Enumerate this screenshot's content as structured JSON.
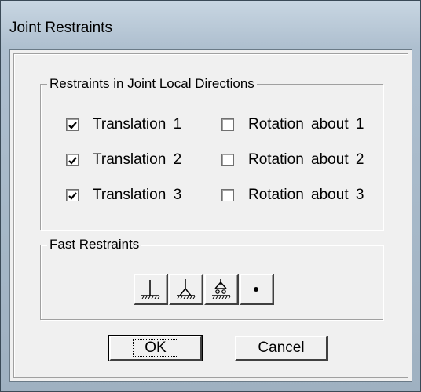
{
  "window": {
    "title": "Joint Restraints"
  },
  "restraints_group": {
    "label": "Restraints in Joint Local Directions",
    "checkboxes": [
      {
        "label": "Translation 1",
        "checked": true
      },
      {
        "label": "Translation 2",
        "checked": true
      },
      {
        "label": "Translation 3",
        "checked": true
      },
      {
        "label": "Rotation about 1",
        "checked": false
      },
      {
        "label": "Rotation about 2",
        "checked": false
      },
      {
        "label": "Rotation about 3",
        "checked": false
      }
    ]
  },
  "fast_group": {
    "label": "Fast Restraints",
    "buttons": [
      {
        "icon": "fixed-support-icon"
      },
      {
        "icon": "pinned-support-icon"
      },
      {
        "icon": "roller-support-icon"
      },
      {
        "icon": "free-joint-icon"
      }
    ]
  },
  "buttons": {
    "ok": "OK",
    "cancel": "Cancel"
  }
}
